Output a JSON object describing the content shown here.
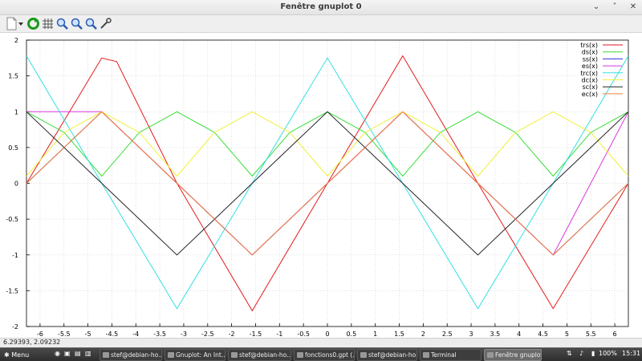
{
  "window": {
    "title": "Fenêtre gnuplot 0",
    "controls": [
      "⌄",
      "˄",
      "✕"
    ]
  },
  "toolbar": {
    "icons": [
      "new-doc-icon",
      "dropdown-arrow-icon",
      "replot-icon",
      "grid-icon",
      "zoom-in-icon",
      "zoom-out-icon",
      "autoscale-icon",
      "settings-icon"
    ]
  },
  "chart_data": {
    "type": "line",
    "xlim": [
      -6.2832,
      6.2832
    ],
    "ylim": [
      -2,
      2
    ],
    "xticks": [
      "-6",
      "-5.5",
      "-5",
      "-4.5",
      "-4",
      "-3.5",
      "-3",
      "-2.5",
      "-2",
      "-1.5",
      "-1",
      "-0.5",
      "0",
      "0.5",
      "1",
      "1.5",
      "2",
      "2.5",
      "3",
      "3.5",
      "4",
      "4.5",
      "5",
      "5.5",
      "6"
    ],
    "yticks": [
      "-2",
      "-1.5",
      "-1",
      "-0.5",
      "0",
      "0.5",
      "1",
      "1.5",
      "2"
    ],
    "grid": true,
    "legend": "top-right",
    "series": [
      {
        "name": "trs(x)",
        "color": "#e41a1c",
        "x": [
          -6.2832,
          -4.7124,
          -4.4,
          -3.1416,
          -1.5708,
          0,
          1.5708,
          3.1416,
          4.7124,
          6.2832
        ],
        "y": [
          0,
          1.75,
          1.7,
          0,
          -1.78,
          0,
          1.78,
          0,
          -1.75,
          0
        ]
      },
      {
        "name": "ds(x)",
        "color": "#33dd33",
        "x": [
          -6.2832,
          -5.4978,
          -4.7124,
          -3.927,
          -3.1416,
          -2.3562,
          -1.5708,
          -0.7854,
          0,
          0.7854,
          1.5708,
          2.3562,
          3.1416,
          3.927,
          4.7124,
          5.4978,
          6.2832
        ],
        "y": [
          1,
          0.71,
          0.1,
          0.71,
          1,
          0.71,
          0.1,
          0.71,
          1,
          0.71,
          0.1,
          0.71,
          1,
          0.71,
          0.1,
          0.71,
          1
        ]
      },
      {
        "name": "ss(x)",
        "color": "#3333dd",
        "x": [
          -6.2832,
          -4.7124,
          -3.1416,
          -1.5708,
          0,
          1.5708,
          3.1416,
          4.7124,
          6.2832
        ],
        "y": [
          0,
          1,
          0,
          -1,
          0,
          1,
          0,
          -1,
          0
        ]
      },
      {
        "name": "es(x)",
        "color": "#dd33dd",
        "x": [
          -6.2832,
          -4.7124,
          -3.1416,
          -1.5708,
          0,
          1.5708,
          3.1416,
          4.7124,
          6.2832
        ],
        "y": [
          1,
          1,
          0,
          -1,
          0,
          1,
          0,
          -1,
          1
        ]
      },
      {
        "name": "trc(x)",
        "color": "#33e0e0",
        "x": [
          -6.2832,
          -4.7124,
          -3.1416,
          -1.5708,
          0,
          1.5708,
          3.1416,
          4.7124,
          6.2832
        ],
        "y": [
          1.78,
          0,
          -1.75,
          0,
          1.75,
          0,
          -1.75,
          0,
          1.78
        ]
      },
      {
        "name": "dc(x)",
        "color": "#f0f033",
        "x": [
          -6.2832,
          -5.4978,
          -4.7124,
          -3.927,
          -3.1416,
          -2.3562,
          -1.5708,
          -0.7854,
          0,
          0.7854,
          1.5708,
          2.3562,
          3.1416,
          3.927,
          4.7124,
          5.4978,
          6.2832
        ],
        "y": [
          0.1,
          0.71,
          1,
          0.71,
          0.1,
          0.71,
          1,
          0.71,
          0.1,
          0.71,
          1,
          0.71,
          0.1,
          0.71,
          1,
          0.71,
          0.1
        ]
      },
      {
        "name": "sc(x)",
        "color": "#222222",
        "x": [
          -6.2832,
          -4.7124,
          -3.1416,
          -1.5708,
          0,
          1.5708,
          3.1416,
          4.7124,
          6.2832
        ],
        "y": [
          1,
          0,
          -1,
          0,
          1,
          0,
          -1,
          0,
          1
        ]
      },
      {
        "name": "ec(x)",
        "color": "#f08030",
        "x": [
          -6.2832,
          -4.7124,
          -3.1416,
          -1.5708,
          0,
          1.5708,
          3.1416,
          4.7124,
          6.2832
        ],
        "y": [
          0,
          1,
          0,
          -1,
          0,
          1,
          0,
          -1,
          0
        ]
      }
    ]
  },
  "status": {
    "coords": "6.29393,  2.09232"
  },
  "taskbar": {
    "menu_label": "Menu",
    "tasks": [
      {
        "label": "stef@debian-ho...",
        "active": false
      },
      {
        "label": "Gnuplot: An Int...",
        "active": false
      },
      {
        "label": "stef@debian-ho...",
        "active": false
      },
      {
        "label": "fonctions0.gpt (...",
        "active": false
      },
      {
        "label": "stef@debian-ho...",
        "active": false
      },
      {
        "label": "Terminal",
        "active": false
      },
      {
        "label": "Fenêtre gnuplot 0",
        "active": true
      }
    ],
    "battery": "100%",
    "clock": "15:31"
  }
}
